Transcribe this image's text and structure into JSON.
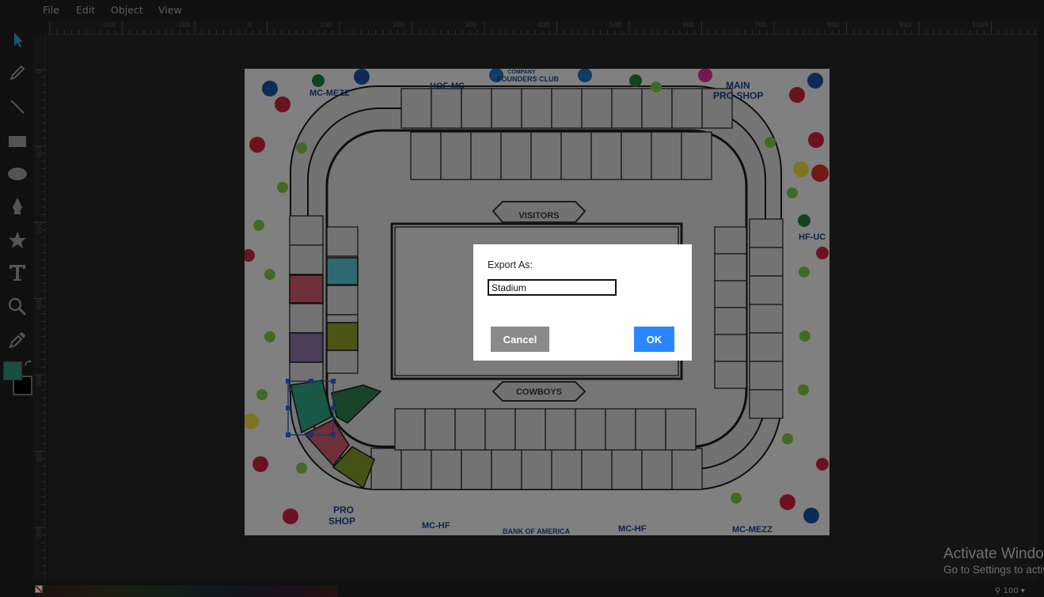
{
  "menu": [
    "File",
    "Edit",
    "Object",
    "View"
  ],
  "ruler": {
    "h_labels": [
      "-200",
      "-100",
      "0",
      "100",
      "200",
      "300",
      "400",
      "500",
      "600",
      "700",
      "800",
      "900",
      "1000"
    ],
    "v_labels": [
      "0",
      "100",
      "200",
      "300",
      "400",
      "500",
      "600"
    ]
  },
  "tools": [
    "select-icon",
    "pencil-icon",
    "line-icon",
    "rectangle-icon",
    "ellipse-icon",
    "pen-icon",
    "star-icon",
    "text-icon",
    "zoom-icon",
    "eyedropper-icon"
  ],
  "colors": {
    "fill": "#2f8f7a",
    "stroke": "#000000",
    "accent_select": "#2a86ff"
  },
  "artboard": {
    "labels": {
      "visitors": "VISITORS",
      "cowboys": "COWBOYS",
      "hof_mc": "HOF-MC",
      "mc_mezz_top": "MC-MEZZ",
      "founders": "FOUNDERS CLUB",
      "company": "COMPANY",
      "main_pro_shop_1": "MAIN",
      "main_pro_shop_2": "PRO SHOP",
      "hf_uc": "HF-UC",
      "pro_shop_1": "PRO",
      "pro_shop_2": "SHOP",
      "mc_hf_1": "MC-HF",
      "mc_hf_2": "MC-HF",
      "bank": "BANK OF AMERICA",
      "mc_mezz_bottom": "MC-MEZZ"
    },
    "section_colors": [
      "#56c2cc",
      "#c9586a",
      "#8a6fa0",
      "#8c9a2a",
      "#2e9e82",
      "#2e7a4e",
      "#c9586a",
      "#7d9a2a"
    ]
  },
  "dialog": {
    "label": "Export As:",
    "input_value": "Stadium",
    "cancel_label": "Cancel",
    "ok_label": "OK"
  },
  "watermark": {
    "title": "Activate Windows",
    "subtitle": "Go to Settings to activate Windows."
  },
  "zoom": "100"
}
